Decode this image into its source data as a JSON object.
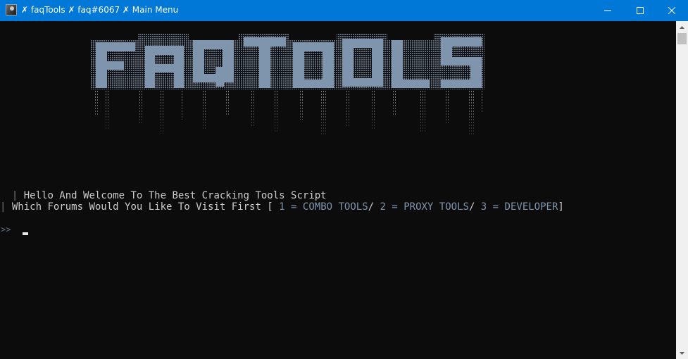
{
  "window": {
    "title": "✗ faqTools ✗ faq#6067 ✗ Main Menu",
    "icon": "app-avatar-icon",
    "accent": "#0078d7"
  },
  "banner": {
    "text": "FAQTOOLS",
    "color": "#7f94ad"
  },
  "console": {
    "bar": "|",
    "welcome": "Hello And Welcome To The Best Cracking Tools Script",
    "question": "Which Forums Would You Like To Visit First [ ",
    "options": [
      {
        "num": "1",
        "eq": " = ",
        "label": "COMBO TOOLS",
        "sep": "/ "
      },
      {
        "num": "2",
        "eq": " = ",
        "label": "PROXY TOOLS",
        "sep": "/ "
      },
      {
        "num": "3",
        "eq": " = ",
        "label": "DEVELOPER",
        "sep": "]"
      }
    ],
    "prompt": ">>",
    "background": "#0c0c0c",
    "text_color": "#cccccc",
    "highlight_color": "#7f94ad"
  }
}
